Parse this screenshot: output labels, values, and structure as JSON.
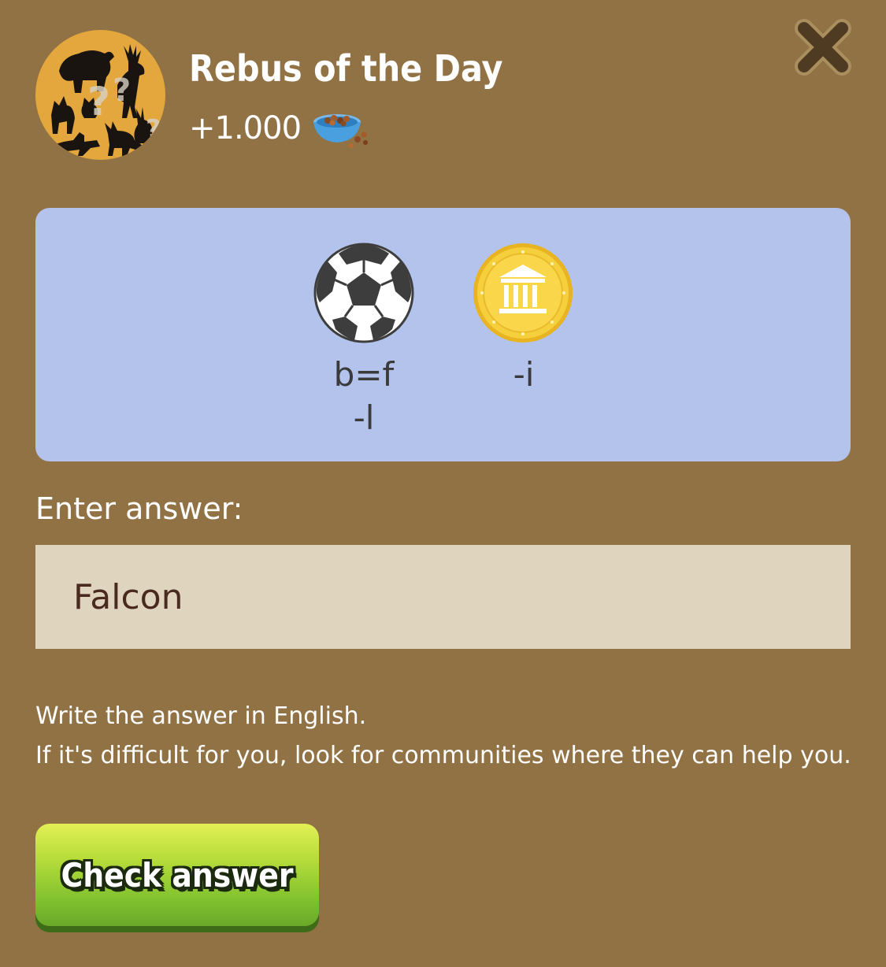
{
  "header": {
    "title": "Rebus of the Day",
    "reward_amount": "+1.000",
    "reward_icon": "pet-food-bowl-icon"
  },
  "rebus": {
    "items": [
      {
        "icon": "soccer-ball-icon",
        "hints": [
          "b=f",
          "-l"
        ]
      },
      {
        "icon": "gold-coin-icon",
        "hints": [
          "-i"
        ]
      }
    ]
  },
  "form": {
    "label": "Enter answer:",
    "answer_value": "Falcon"
  },
  "help": {
    "line1": "Write the answer in English.",
    "line2": "If it's difficult for you, look for communities where they can help you."
  },
  "actions": {
    "check_label": "Check answer"
  },
  "colors": {
    "background": "#917245",
    "panel": "#b3c3ec",
    "input": "#dfd4bd",
    "button_top": "#e2ef55",
    "button_bottom": "#6aa829",
    "avatar": "#e3a73d",
    "close": "#4e3b22"
  }
}
